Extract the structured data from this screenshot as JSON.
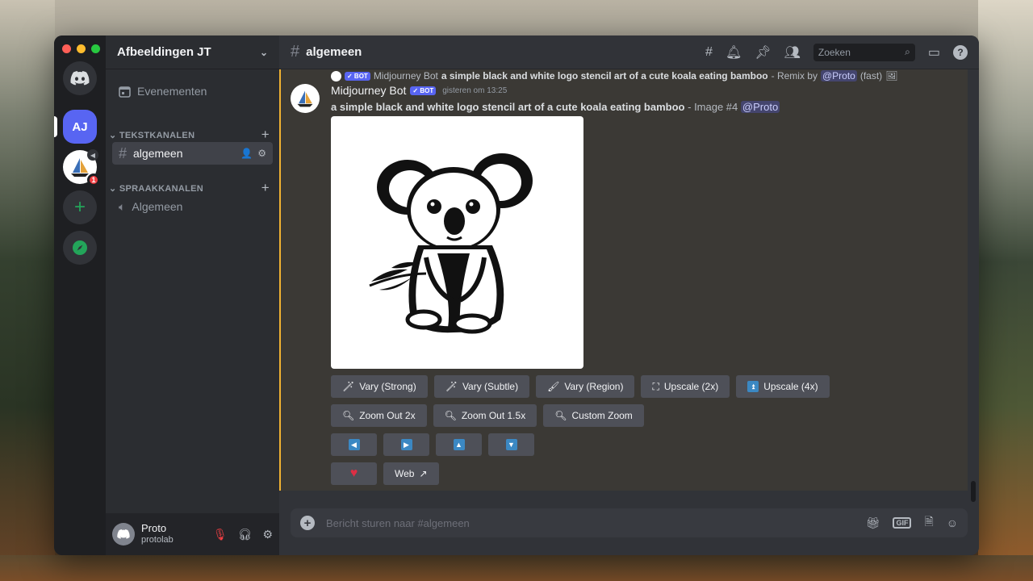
{
  "server_rail": {
    "active_server_initials": "AJ",
    "notification_count": "1"
  },
  "sidebar": {
    "server_name": "Afbeeldingen JT",
    "events_label": "Evenementen",
    "text_category": "TEKSTKANALEN",
    "text_channel": "algemeen",
    "voice_category": "SPRAAKKANALEN",
    "voice_channel": "Algemeen"
  },
  "user": {
    "name": "Proto",
    "tag": "protolab"
  },
  "header": {
    "channel_name": "algemeen",
    "search_placeholder": "Zoeken"
  },
  "reply": {
    "bot_tag": "✓ BOT",
    "author": "Midjourney Bot",
    "prompt": "a simple black and white logo stencil art of a cute koala eating bamboo",
    "suffix": "- Remix by",
    "mention": "@Proto",
    "mode": "(fast)"
  },
  "message": {
    "author": "Midjourney Bot",
    "bot_tag": "✓ BOT",
    "timestamp": "gisteren om 13:25",
    "prompt": "a simple black and white logo stencil art of a cute koala eating bamboo",
    "suffix": "- Image #4",
    "mention": "@Proto"
  },
  "buttons": {
    "vary_strong": "Vary (Strong)",
    "vary_subtle": "Vary (Subtle)",
    "vary_region": "Vary (Region)",
    "upscale_2x": "Upscale (2x)",
    "upscale_4x": "Upscale (4x)",
    "zoom_out_2x": "Zoom Out 2x",
    "zoom_out_15x": "Zoom Out 1.5x",
    "custom_zoom": "Custom Zoom",
    "web": "Web"
  },
  "composer": {
    "placeholder": "Bericht sturen naar #algemeen"
  },
  "colors": {
    "blurple": "#5865f2",
    "highlight_border": "#f0b232",
    "button": "#4e5058"
  }
}
